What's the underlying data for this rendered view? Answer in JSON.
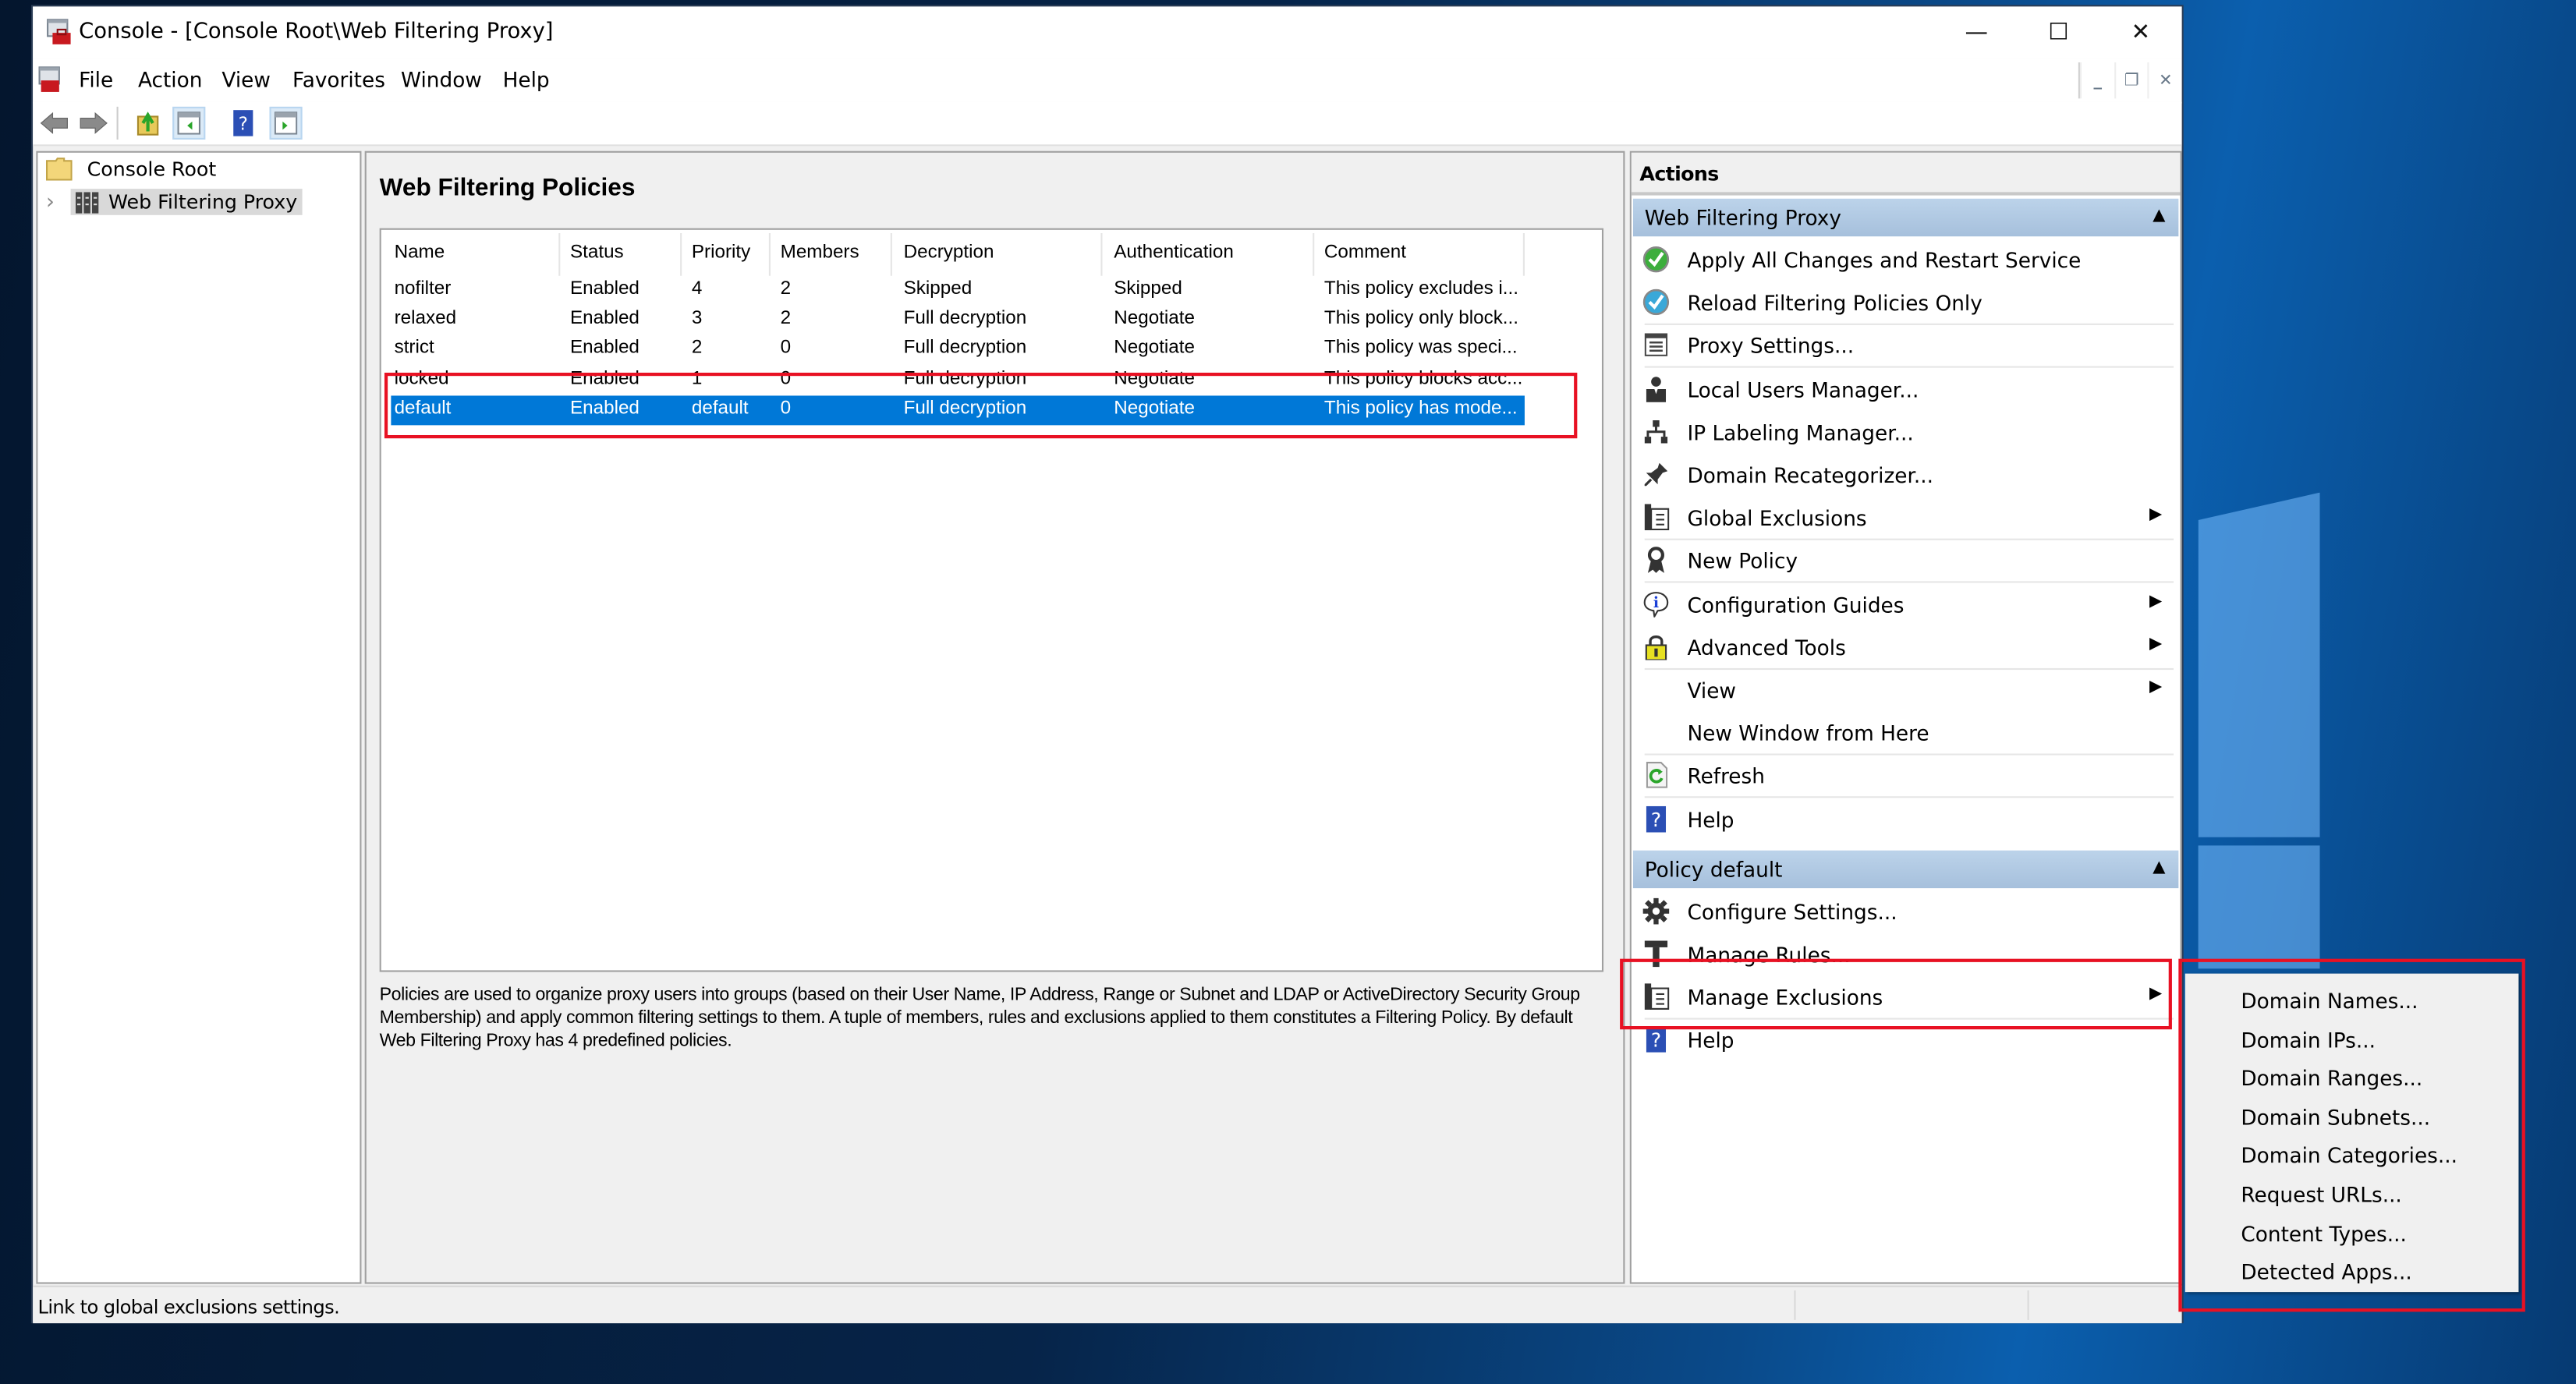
{
  "window": {
    "title": "Console - [Console Root\\Web Filtering Proxy]",
    "caption_buttons": {
      "minimize": "—",
      "maximize": "☐",
      "close": "✕"
    }
  },
  "menubar": {
    "items": [
      "File",
      "Action",
      "View",
      "Favorites",
      "Window",
      "Help"
    ],
    "mdi_controls": {
      "minimize": "_",
      "restore": "❐",
      "close": "✕"
    }
  },
  "toolbar": {
    "buttons": [
      "back",
      "forward",
      "up-one-level",
      "show-hide-console-tree",
      "help",
      "show-hide-action-pane"
    ]
  },
  "tree": {
    "items": [
      {
        "label": "Console Root",
        "icon": "folder-icon"
      },
      {
        "label": "Web Filtering Proxy",
        "icon": "server-icon",
        "selected": true,
        "expander": "›"
      }
    ]
  },
  "center": {
    "title": "Web Filtering Policies",
    "columns": [
      "Name",
      "Status",
      "Priority",
      "Members",
      "Decryption",
      "Authentication",
      "Comment"
    ],
    "rows": [
      {
        "name": "nofilter",
        "status": "Enabled",
        "priority": "4",
        "members": "2",
        "decryption": "Skipped",
        "authentication": "Skipped",
        "comment": "This policy excludes i..."
      },
      {
        "name": "relaxed",
        "status": "Enabled",
        "priority": "3",
        "members": "2",
        "decryption": "Full decryption",
        "authentication": "Negotiate",
        "comment": "This policy only block..."
      },
      {
        "name": "strict",
        "status": "Enabled",
        "priority": "2",
        "members": "0",
        "decryption": "Full decryption",
        "authentication": "Negotiate",
        "comment": "This policy was speci..."
      },
      {
        "name": "locked",
        "status": "Enabled",
        "priority": "1",
        "members": "0",
        "decryption": "Full decryption",
        "authentication": "Negotiate",
        "comment": "This policy blocks acc..."
      },
      {
        "name": "default",
        "status": "Enabled",
        "priority": "default",
        "members": "0",
        "decryption": "Full decryption",
        "authentication": "Negotiate",
        "comment": "This policy has mode...",
        "selected": true
      }
    ],
    "description": "Policies are used to organize proxy users into groups (based on their User Name, IP Address, Range or Subnet and LDAP or ActiveDirectory Security Group Membership) and apply common filtering settings to them. A tuple of members, rules and exclusions applied to them constitutes a Filtering Policy. By default Web Filtering Proxy has 4 predefined policies."
  },
  "actions": {
    "title": "Actions",
    "groups": [
      {
        "label": "Web Filtering Proxy",
        "collapse": "▲",
        "items": [
          {
            "label": "Apply All Changes and Restart Service",
            "icon": "green-check-icon"
          },
          {
            "label": "Reload Filtering Policies Only",
            "icon": "blue-check-icon"
          },
          {
            "label": "Proxy Settings...",
            "icon": "settings-form-icon"
          },
          {
            "label": "Local Users Manager...",
            "icon": "user-icon"
          },
          {
            "label": "IP Labeling Manager...",
            "icon": "network-icon"
          },
          {
            "label": "Domain Recategorizer...",
            "icon": "pin-icon"
          },
          {
            "label": "Global Exclusions",
            "icon": "exclusions-icon",
            "submenu": true
          },
          {
            "label": "New Policy",
            "icon": "ribbon-icon"
          },
          {
            "label": "Configuration Guides",
            "icon": "info-icon",
            "submenu": true
          },
          {
            "label": "Advanced Tools",
            "icon": "lock-icon",
            "submenu": true
          },
          {
            "label": "View",
            "icon": "",
            "submenu": true
          },
          {
            "label": "New Window from Here",
            "icon": ""
          },
          {
            "label": "Refresh",
            "icon": "refresh-icon"
          },
          {
            "label": "Help",
            "icon": "help-icon"
          }
        ]
      },
      {
        "label": "Policy default",
        "collapse": "▲",
        "items": [
          {
            "label": "Configure Settings...",
            "icon": "gear-icon"
          },
          {
            "label": "Manage Rules...",
            "icon": "hammer-icon"
          },
          {
            "label": "Manage Exclusions",
            "icon": "exclusions-icon",
            "submenu": true
          },
          {
            "label": "Help",
            "icon": "help-icon"
          }
        ]
      }
    ]
  },
  "submenu": {
    "items": [
      "Domain Names...",
      "Domain IPs...",
      "Domain Ranges...",
      "Domain Subnets...",
      "Domain Categories...",
      "Request URLs...",
      "Content Types...",
      "Detected Apps..."
    ]
  },
  "statusbar": {
    "text": "Link to global exclusions settings."
  },
  "colors": {
    "selection": "#0078d7",
    "annotation": "#e81123",
    "group_header": "#b3cbe4"
  }
}
